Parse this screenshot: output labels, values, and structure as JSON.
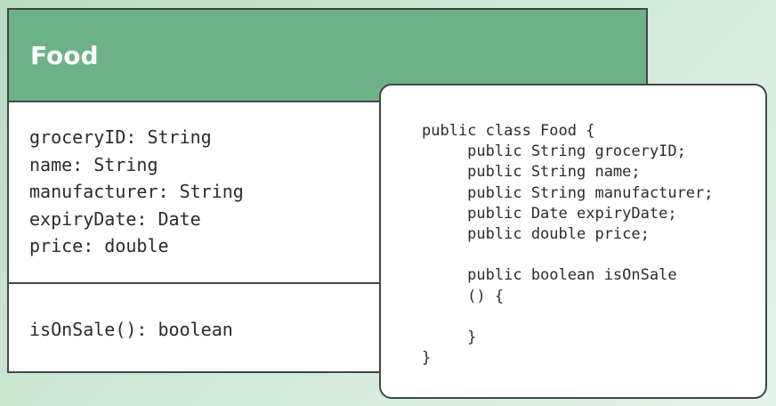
{
  "class_diagram": {
    "name": "Food",
    "attributes": [
      "groceryID: String",
      "name: String",
      "manufacturer: String",
      "expiryDate: Date",
      "price: double"
    ],
    "methods": [
      "isOnSale(): boolean"
    ]
  },
  "code": {
    "lines": [
      "public class Food {",
      "     public String groceryID;",
      "     public String name;",
      "     public String manufacturer;",
      "     public Date expiryDate;",
      "     public double price;",
      "",
      "     public boolean isOnSale",
      "     () {",
      "",
      "     }",
      "}"
    ]
  },
  "colors": {
    "header_green": "#6db287",
    "border": "#3f4a44",
    "text": "#2b2b2b"
  }
}
